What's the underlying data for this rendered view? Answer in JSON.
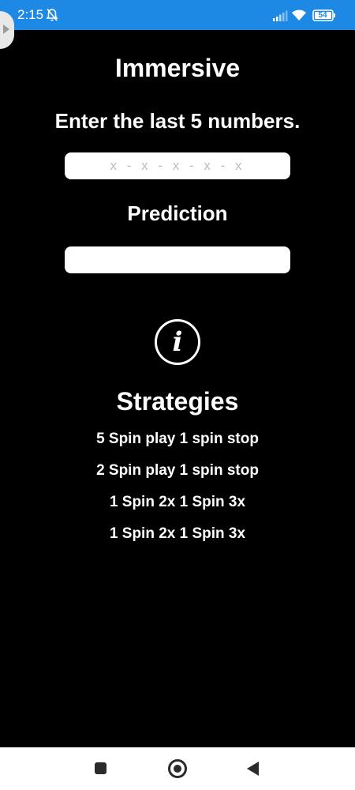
{
  "status_bar": {
    "time": "2:15",
    "battery_level": "54",
    "background_color": "#1e88e5",
    "icons": [
      "bell-off-icon",
      "signal-icon",
      "wifi-icon",
      "battery-icon"
    ]
  },
  "main": {
    "title": "Immersive",
    "instruction": "Enter the last 5 numbers.",
    "numbers_input": {
      "placeholder": "x - x - x - x - x",
      "value": ""
    },
    "prediction_label": "Prediction",
    "prediction_value": "",
    "info_icon": "info-icon"
  },
  "strategies": {
    "title": "Strategies",
    "items": [
      "5 Spin play 1 spin stop",
      "2 Spin play 1 spin stop",
      "1 Spin 2x 1 Spin 3x",
      "1 Spin 2x 1 Spin 3x"
    ]
  },
  "nav_bar": {
    "icons": [
      "recent-apps-icon",
      "home-icon",
      "back-icon"
    ]
  },
  "colors": {
    "background": "#000000",
    "text": "#ffffff",
    "field": "#ffffff"
  }
}
